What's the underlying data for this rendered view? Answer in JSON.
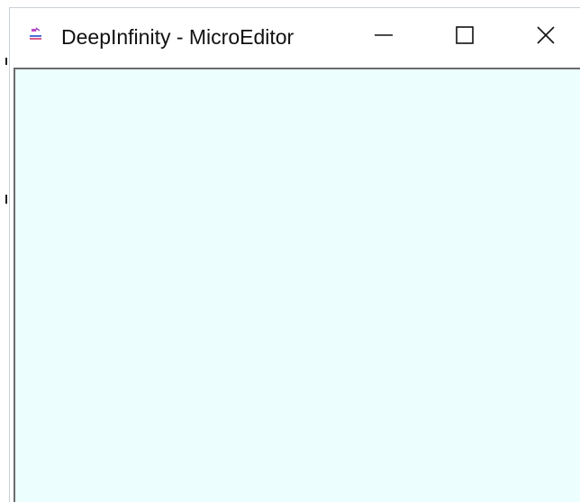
{
  "window": {
    "title": "DeepInfinity - MicroEditor",
    "app_icon": "paint-brush-icon",
    "controls": {
      "minimize_icon": "minimize-icon",
      "maximize_icon": "maximize-icon",
      "close_icon": "close-icon"
    }
  },
  "editor": {
    "canvas_color": "#ecfefe",
    "content": ""
  }
}
